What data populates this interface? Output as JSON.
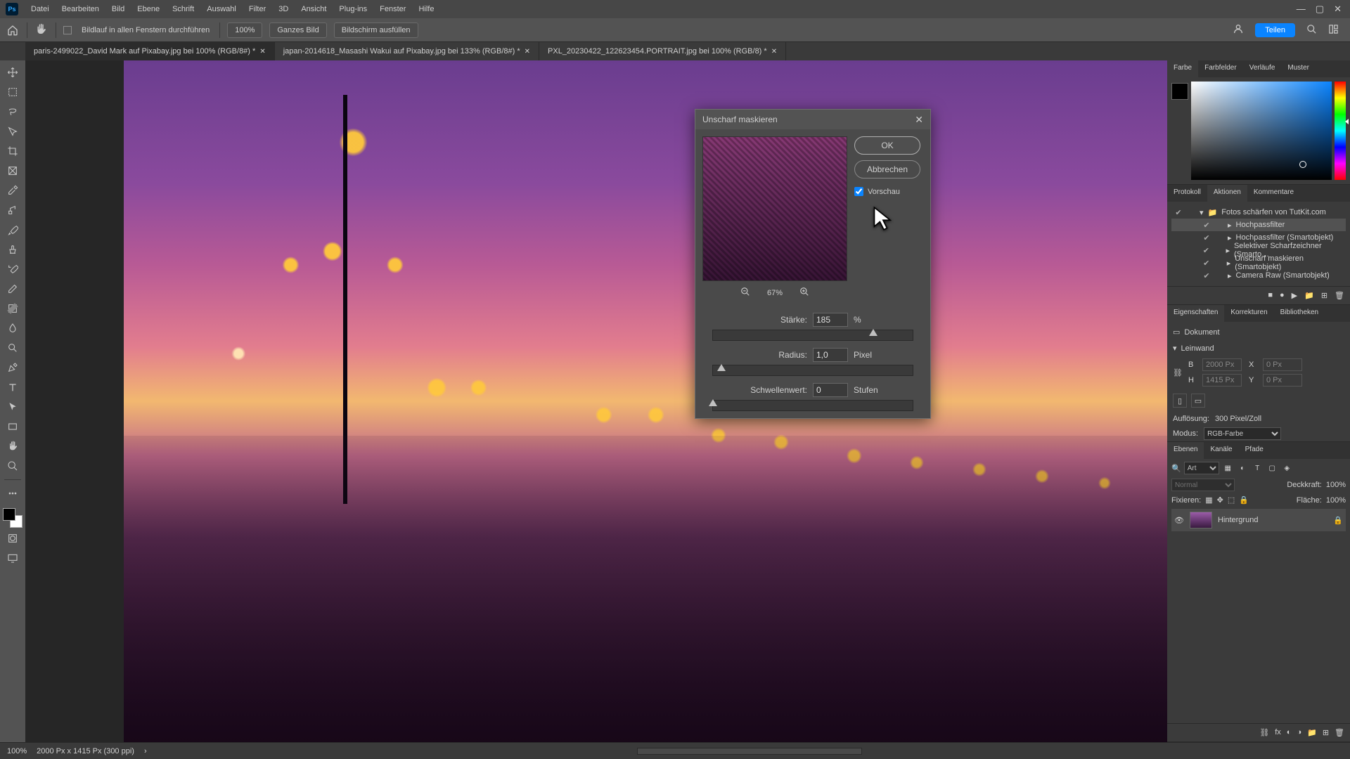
{
  "menu": {
    "items": [
      "Datei",
      "Bearbeiten",
      "Bild",
      "Ebene",
      "Schrift",
      "Auswahl",
      "Filter",
      "3D",
      "Ansicht",
      "Plug-ins",
      "Fenster",
      "Hilfe"
    ]
  },
  "optionsbar": {
    "scroll_all": "Bildlauf in allen Fenstern durchführen",
    "zoom": "100%",
    "fit": "Ganzes Bild",
    "fill": "Bildschirm ausfüllen",
    "share": "Teilen"
  },
  "tabs": [
    {
      "label": "paris-2499022_David Mark auf Pixabay.jpg bei 100% (RGB/8#) *",
      "active": true
    },
    {
      "label": "japan-2014618_Masashi Wakui auf Pixabay.jpg bei 133% (RGB/8#) *",
      "active": false
    },
    {
      "label": "PXL_20230422_122623454.PORTRAIT.jpg bei 100% (RGB/8) *",
      "active": false
    }
  ],
  "dialog": {
    "title": "Unscharf maskieren",
    "ok": "OK",
    "cancel": "Abbrechen",
    "preview_label": "Vorschau",
    "preview_checked": true,
    "zoom_pct": "67%",
    "strength_label": "Stärke:",
    "strength_value": "185",
    "strength_unit": "%",
    "radius_label": "Radius:",
    "radius_value": "1,0",
    "radius_unit": "Pixel",
    "threshold_label": "Schwellenwert:",
    "threshold_value": "0",
    "threshold_unit": "Stufen"
  },
  "color_panel": {
    "tabs": [
      "Farbe",
      "Farbfelder",
      "Verläufe",
      "Muster"
    ]
  },
  "actions_panel": {
    "tabs": [
      "Protokoll",
      "Aktionen",
      "Kommentare"
    ],
    "set": "Fotos schärfen von TutKit.com",
    "rows": [
      "Hochpassfilter",
      "Hochpassfilter (Smartobjekt)",
      "Selektiver Scharfzeichner (Smarto…",
      "Unscharf maskieren (Smartobjekt)",
      "Camera Raw (Smartobjekt)"
    ]
  },
  "props_panel": {
    "tabs": [
      "Eigenschaften",
      "Korrekturen",
      "Bibliotheken"
    ],
    "doc_label": "Dokument",
    "leinwand": "Leinwand",
    "w": "B",
    "h": "H",
    "x": "X",
    "y": "Y",
    "w_val": "2000 Px",
    "h_val": "1415 Px",
    "x_val": "0 Px",
    "y_val": "0 Px",
    "res_label": "Auflösung:",
    "res_val": "300 Pixel/Zoll",
    "mode_label": "Modus:",
    "mode_val": "RGB-Farbe"
  },
  "layers_panel": {
    "tabs": [
      "Ebenen",
      "Kanäle",
      "Pfade"
    ],
    "search_kind": "Art",
    "blend": "Normal",
    "opacity_label": "Deckkraft:",
    "opacity_val": "100%",
    "lock_label": "Fixieren:",
    "fill_label": "Fläche:",
    "fill_val": "100%",
    "layer_name": "Hintergrund"
  },
  "status": {
    "zoom": "100%",
    "info": "2000 Px x 1415 Px (300 ppi)"
  }
}
